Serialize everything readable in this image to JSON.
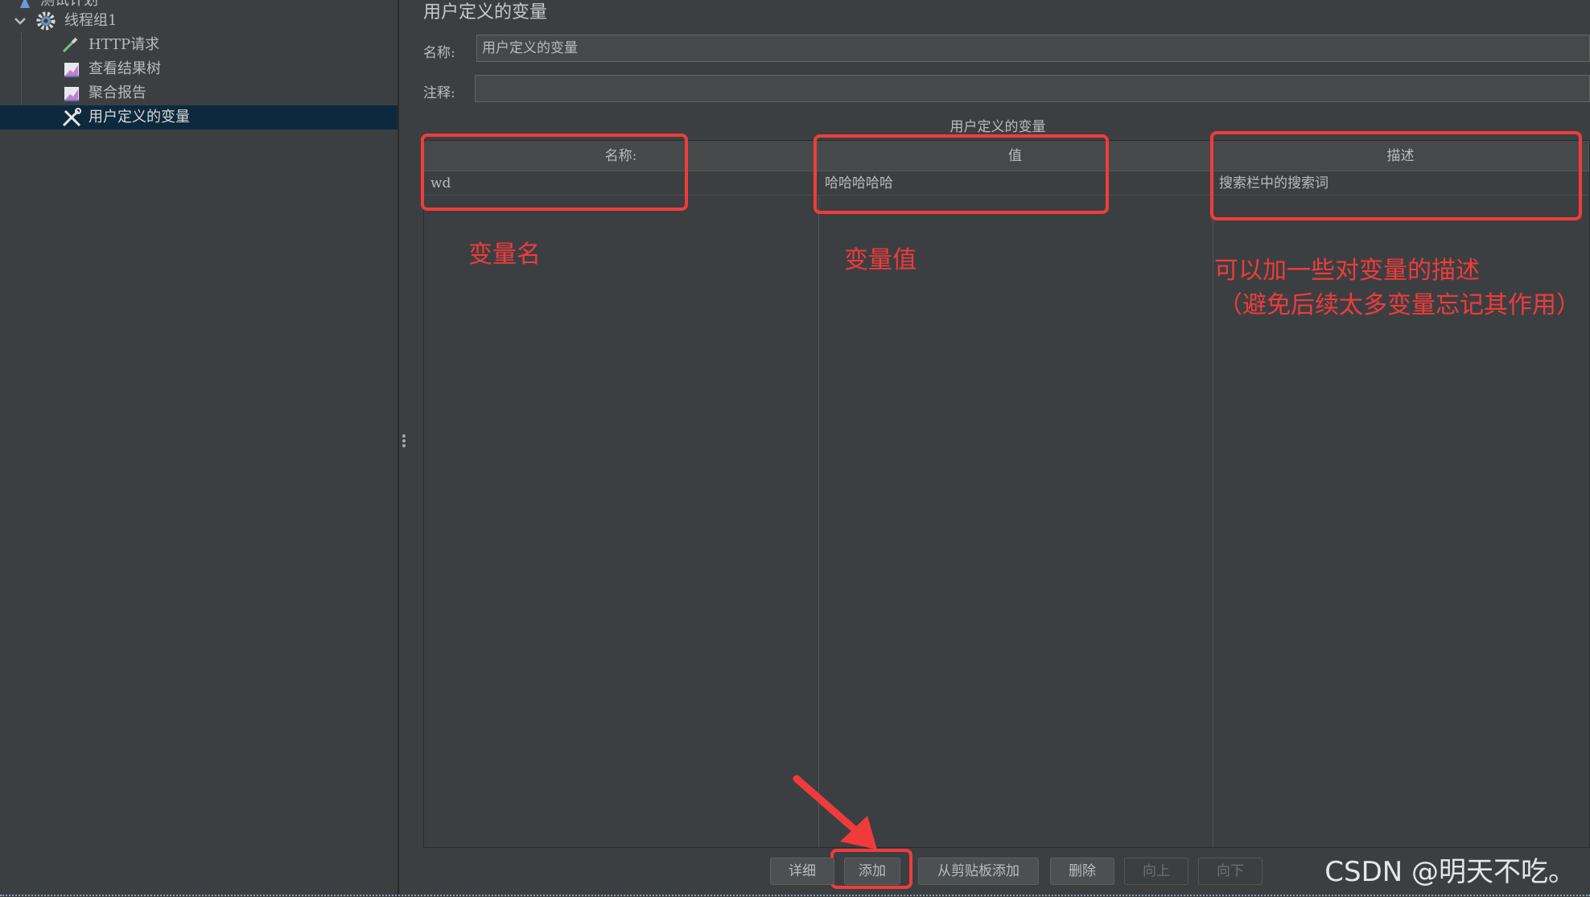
{
  "tree": {
    "items": [
      {
        "label": "测试计划"
      },
      {
        "label": "线程组1"
      },
      {
        "label": "HTTP请求"
      },
      {
        "label": "查看结果树"
      },
      {
        "label": "聚合报告"
      },
      {
        "label": "用户定义的变量"
      }
    ],
    "selected_index": 5
  },
  "panel": {
    "title": "用户定义的变量",
    "name_label": "名称:",
    "name_value": "用户定义的变量",
    "comment_label": "注释:",
    "comment_value": ""
  },
  "table": {
    "caption": "用户定义的变量",
    "columns": [
      "名称:",
      "值",
      "描述"
    ],
    "rows": [
      [
        "wd",
        "哈哈哈哈哈",
        "搜索栏中的搜索词"
      ]
    ]
  },
  "buttons": [
    {
      "label": "详细",
      "enabled": true
    },
    {
      "label": "添加",
      "enabled": true
    },
    {
      "label": "从剪贴板添加",
      "enabled": true
    },
    {
      "label": "删除",
      "enabled": true
    },
    {
      "label": "向上",
      "enabled": false
    },
    {
      "label": "向下",
      "enabled": false
    }
  ],
  "annotations": {
    "name": "变量名",
    "value": "变量值",
    "desc_line1": "可以加一些对变量的描述",
    "desc_line2": "（避免后续太多变量忘记其作用）",
    "color": "#ef3b3b"
  },
  "watermark": "CSDN @明天不吃。",
  "colors": {
    "background": "#3c3f41",
    "selection": "#0d293e",
    "highlight_box": "#f03c3c"
  }
}
